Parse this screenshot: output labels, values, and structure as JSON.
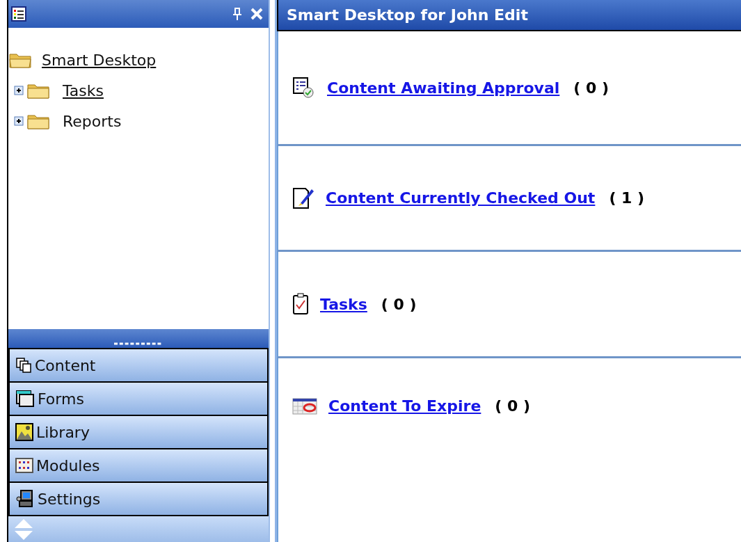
{
  "sidebar": {
    "tree": [
      {
        "label": "Smart Desktop",
        "kind": "link",
        "expanded": true,
        "children": [
          {
            "label": "Tasks",
            "kind": "link",
            "expanded": false
          },
          {
            "label": "Reports",
            "kind": "text",
            "expanded": false
          }
        ]
      }
    ],
    "sections": [
      {
        "label": "Content"
      },
      {
        "label": "Forms"
      },
      {
        "label": "Library"
      },
      {
        "label": "Modules"
      },
      {
        "label": "Settings"
      }
    ]
  },
  "main": {
    "title": "Smart Desktop for John Edit",
    "items": [
      {
        "label": "Content Awaiting Approval",
        "count": "( 0 )"
      },
      {
        "label": "Content Currently Checked Out",
        "count": "( 1 )"
      },
      {
        "label": "Tasks",
        "count": "( 0 )"
      },
      {
        "label": "Content To Expire",
        "count": "( 0 )"
      }
    ]
  }
}
